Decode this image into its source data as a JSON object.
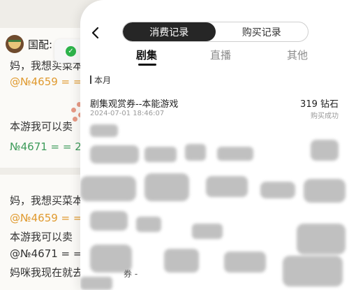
{
  "background": {
    "chat_title": "国配:",
    "lines": [
      {
        "text": "妈，我想买菜本",
        "style": "gray"
      },
      {
        "text": "@№4659 = = 2",
        "style": "orange"
      },
      {
        "text": "本游我可以卖",
        "style": "gray"
      },
      {
        "text": "№4671 = = 2024",
        "style": "green"
      },
      {
        "text": "妈，我想买菜本",
        "style": "gray"
      },
      {
        "text": "@№4659 = = 2",
        "style": "orange"
      },
      {
        "text": "本游我可以卖",
        "style": "gray"
      },
      {
        "text": "@№4671 = = 2(",
        "style": "gray"
      },
      {
        "text": "妈咪我现在就去",
        "style": "gray"
      }
    ]
  },
  "sheet": {
    "segment": {
      "active": "消费记录",
      "inactive": "购买记录"
    },
    "tabs": [
      "剧集",
      "直播",
      "其他"
    ],
    "section_label": "本月",
    "records": [
      {
        "name": "剧集观赏券--本能游戏",
        "time": "2024-07-01 18:46:07",
        "amount": "319 钻石",
        "status": "购买成功"
      }
    ],
    "obscured_fragments": [
      "券 -"
    ]
  }
}
